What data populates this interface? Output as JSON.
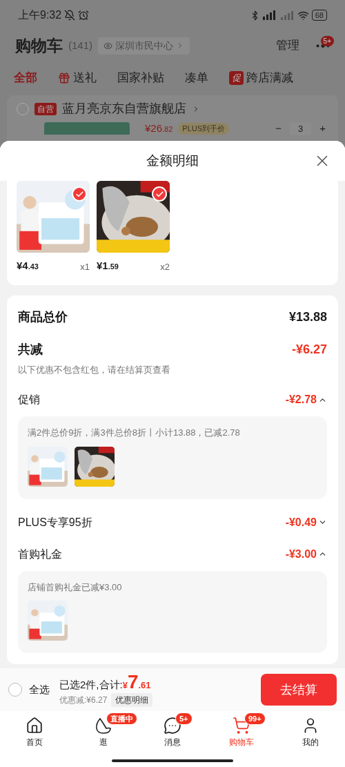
{
  "status_bar": {
    "time": "上午9:32",
    "battery": "68"
  },
  "header": {
    "title": "购物车",
    "count": "(141)",
    "location": "深圳市民中心",
    "manage": "管理",
    "more_badge": "5+"
  },
  "filter_tabs": [
    {
      "label": "全部",
      "selected": true,
      "kind": "plain"
    },
    {
      "label": "送礼",
      "selected": false,
      "kind": "gift"
    },
    {
      "label": "国家补贴",
      "selected": false,
      "kind": "plain"
    },
    {
      "label": "凑单",
      "selected": false,
      "kind": "plain"
    },
    {
      "label": "跨店满减",
      "selected": false,
      "kind": "promo",
      "tag": "促"
    }
  ],
  "store": {
    "checked": false,
    "tag": "自营",
    "name": "蓝月亮京东自营旗舰店",
    "price": "¥26",
    "price_decimal": ".82",
    "price_tag": "PLUS到手价",
    "minus": "−",
    "quantity": "3",
    "plus": "+"
  },
  "sheet": {
    "title": "金额明细",
    "items": [
      {
        "kind": "tissue",
        "selected": true,
        "price": "¥4",
        "price_decimal": ".43",
        "quantity": "x1"
      },
      {
        "kind": "scrubber",
        "selected": true,
        "price": "¥1",
        "price_decimal": ".59",
        "quantity": "x2"
      }
    ],
    "total_label": "商品总价",
    "total": "¥13.88",
    "discount_label": "共减",
    "discount": "-¥6.27",
    "note": "以下优惠不包含红包，请在结算页查看",
    "promotions": [
      {
        "label": "促销",
        "amount": "-¥2.78",
        "expanded": true,
        "detail": "满2件总价9折，满3件总价8折丨小计13.88，已减2.78",
        "thumbs": [
          {
            "kind": "tissue"
          },
          {
            "kind": "scrubber"
          }
        ]
      },
      {
        "label": "PLUS专享95折",
        "amount": "-¥0.49",
        "expanded": false
      },
      {
        "label": "首购礼金",
        "amount": "-¥3.00",
        "expanded": true,
        "detail": "店铺首购礼金已减¥3.00",
        "thumbs": [
          {
            "kind": "tissue"
          }
        ]
      }
    ]
  },
  "checkout": {
    "select_all": {
      "label": "全选",
      "checked": false
    },
    "summary": "已选2件,合计:",
    "currency": "¥",
    "total": "7",
    "total_decimal": ".61",
    "saving": "优惠减:¥6.27",
    "detail_button": "优惠明细",
    "button": "去结算"
  },
  "tab_bar": [
    {
      "kind": "home",
      "label": "首页",
      "selected": false
    },
    {
      "kind": "browse",
      "label": "逛",
      "selected": false,
      "badge": "直播中"
    },
    {
      "kind": "message",
      "label": "消息",
      "selected": false,
      "badge": "5+"
    },
    {
      "kind": "cart",
      "label": "购物车",
      "selected": true,
      "badge": "99+"
    },
    {
      "kind": "profile",
      "label": "我的",
      "selected": false
    }
  ]
}
